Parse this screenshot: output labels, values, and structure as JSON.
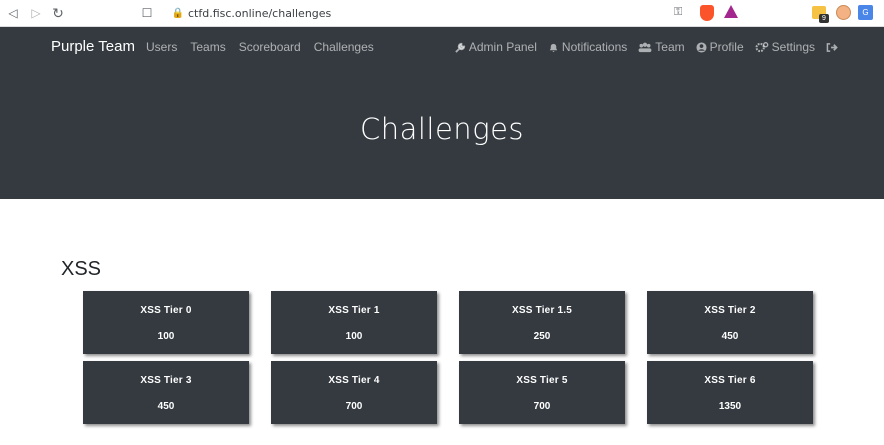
{
  "browser": {
    "url": "ctfd.fisc.online/challenges",
    "ext_badge": "9"
  },
  "navbar": {
    "brand": "Purple Team",
    "links": [
      "Users",
      "Teams",
      "Scoreboard",
      "Challenges"
    ],
    "right": [
      {
        "label": "Admin Panel",
        "icon": "wrench-icon"
      },
      {
        "label": "Notifications",
        "icon": "bell-icon"
      },
      {
        "label": "Team",
        "icon": "users-icon"
      },
      {
        "label": "Profile",
        "icon": "user-circle-icon"
      },
      {
        "label": "Settings",
        "icon": "cogs-icon"
      }
    ]
  },
  "page": {
    "title": "Challenges"
  },
  "categories": [
    {
      "name": "XSS",
      "challenges": [
        {
          "name": "XSS Tier 0",
          "value": "100"
        },
        {
          "name": "XSS Tier 1",
          "value": "100"
        },
        {
          "name": "XSS Tier 1.5",
          "value": "250"
        },
        {
          "name": "XSS Tier 2",
          "value": "450"
        },
        {
          "name": "XSS Tier 3",
          "value": "450"
        },
        {
          "name": "XSS Tier 4",
          "value": "700"
        },
        {
          "name": "XSS Tier 5",
          "value": "700"
        },
        {
          "name": "XSS Tier 6",
          "value": "1350"
        }
      ]
    }
  ],
  "colors": {
    "header_bg": "#343a40",
    "card_bg": "#343a40",
    "brave": "#fb542b",
    "bat": "#a3278f"
  }
}
